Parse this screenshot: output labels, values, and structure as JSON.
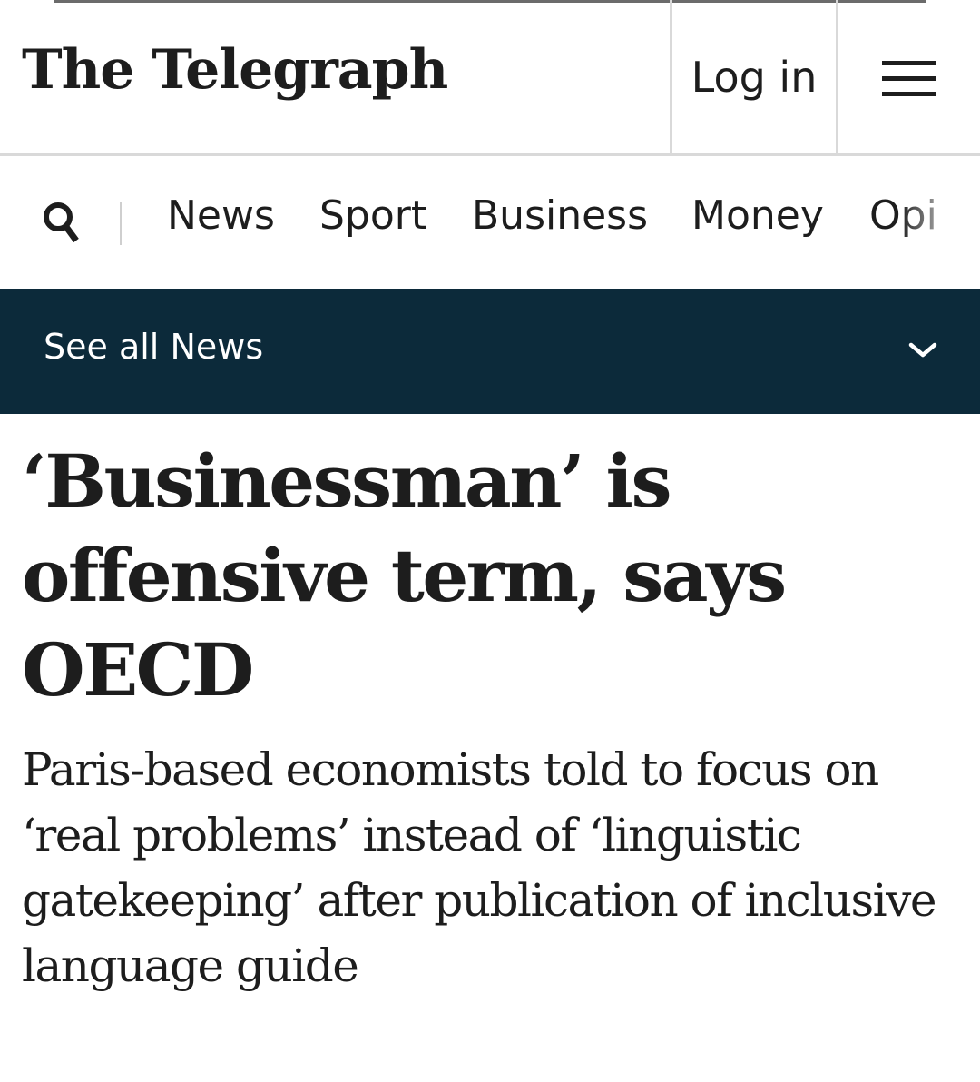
{
  "header": {
    "logo": "The Telegraph",
    "login_label": "Log in",
    "menu_icon": "hamburger-menu-icon"
  },
  "nav": {
    "search_icon": "search-icon",
    "items": [
      "News",
      "Sport",
      "Business",
      "Money",
      "Opi"
    ]
  },
  "section_bar": {
    "label": "See all News",
    "icon": "chevron-down-icon",
    "background": "#0c2a3a"
  },
  "article": {
    "headline": "‘Businessman’ is offensive term, says OECD",
    "standfirst": "Paris-based economists told to focus on ‘real problems’ instead of ‘linguistic gatekeeping’ after publication of inclusive language guide"
  }
}
